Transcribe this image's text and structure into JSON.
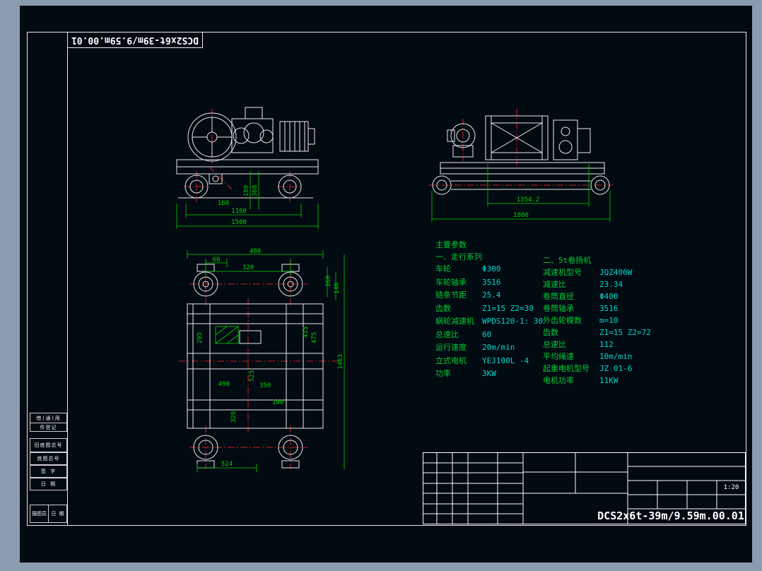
{
  "colors": {
    "desktop": "#8b9cb0",
    "canvas": "#020a12",
    "line": "#ffffff",
    "dimension": "#00d400",
    "centerline": "#ff2a2a",
    "param_label": "#00cc33",
    "param_value": "#00d8cc"
  },
  "top_title": {
    "text": "DCS2x6t-39m/9.59m.00.01"
  },
  "left_margin": {
    "blocks": [
      "借(通)用",
      "件登记",
      "旧底图总号",
      "底图总号",
      "签  字",
      "日  期",
      "描图员",
      "日 期"
    ]
  },
  "params": {
    "title": "主要参数",
    "left": {
      "heading": "一、走行系列",
      "rows": [
        {
          "label": "车轮",
          "value": "Φ300"
        },
        {
          "label": "车轮轴承",
          "value": "3516"
        },
        {
          "label": "链条节距",
          "value": "25.4"
        },
        {
          "label": "齿数",
          "value": "Z1=15  Z2=30"
        },
        {
          "label": "蜗轮减速机",
          "value": "WPDS120-1: 30"
        },
        {
          "label": "总速比",
          "value": "60"
        },
        {
          "label": "运行速度",
          "value": "20m/min"
        },
        {
          "label": "立式电机",
          "value": "YEJ100L -4"
        },
        {
          "label": "功率",
          "value": "3KW"
        }
      ]
    },
    "right": {
      "heading": "二、5t卷扬机",
      "rows": [
        {
          "label": "减速机型号",
          "value": "JQZ400W"
        },
        {
          "label": "减速比",
          "value": "23.34"
        },
        {
          "label": "卷筒直径",
          "value": "Φ400"
        },
        {
          "label": "卷筒轴承",
          "value": "3516"
        },
        {
          "label": "外齿轮模数",
          "value": "m=10"
        },
        {
          "label": "齿数",
          "value": "Z1=15  Z2=72"
        },
        {
          "label": "总速比",
          "value": "112"
        },
        {
          "label": "平均绳速",
          "value": "10m/min"
        },
        {
          "label": "起重电机型号",
          "value": "JZ 01-6"
        },
        {
          "label": "电机功率",
          "value": "11KW"
        }
      ]
    }
  },
  "views": {
    "front": {
      "dims": [
        "160",
        "180",
        "360",
        "1160",
        "1500"
      ]
    },
    "side": {
      "dims": [
        "1354.2",
        "1800"
      ]
    },
    "plan": {
      "dims": [
        "480",
        "60",
        "320",
        "160",
        "140",
        "295",
        "415",
        "475",
        "1463",
        "525",
        "490",
        "350",
        "100",
        "320",
        "524"
      ]
    }
  },
  "title_block": {
    "scale": "1:20",
    "drawing_no": "DCS2x6t-39m/9.59m.00.01"
  }
}
